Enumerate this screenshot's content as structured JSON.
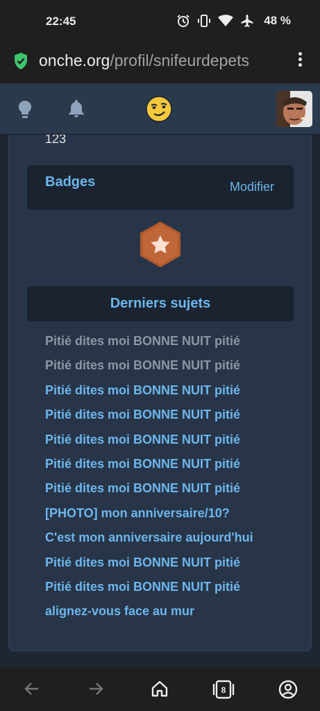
{
  "status_bar": {
    "time": "22:45",
    "battery": "48 %",
    "icons": [
      "alarm-icon",
      "vibrate-icon",
      "wifi-icon",
      "airplane-icon"
    ]
  },
  "browser": {
    "url_domain": "onche.org",
    "url_path": "/profil/snifeurdepets",
    "icons": [
      "shield-check-icon",
      "more-vert-icon"
    ]
  },
  "site_header": {
    "icons": [
      "lightbulb-icon",
      "bell-icon",
      "smiley-logo",
      "avatar"
    ]
  },
  "profile": {
    "number": "123",
    "badges": {
      "title": "Badges",
      "edit_label": "Modifier",
      "badge_icon": "star-hexagon-badge"
    },
    "topics": {
      "title": "Derniers sujets",
      "items": [
        {
          "label": "Pitié dites moi BONNE NUIT pitié",
          "visited": true
        },
        {
          "label": "Pitié dites moi BONNE NUIT pitié",
          "visited": true
        },
        {
          "label": "Pitié dites moi BONNE NUIT pitié",
          "visited": false
        },
        {
          "label": "Pitié dites moi BONNE NUIT pitié",
          "visited": false
        },
        {
          "label": "Pitié dites moi BONNE NUIT pitié",
          "visited": false
        },
        {
          "label": "Pitié dites moi BONNE NUIT pitié",
          "visited": false
        },
        {
          "label": "Pitié dites moi BONNE NUIT pitié",
          "visited": false
        },
        {
          "label": "[PHOTO] mon anniversaire/10?",
          "visited": false
        },
        {
          "label": "C'est mon anniversaire aujourd'hui",
          "visited": false
        },
        {
          "label": "Pitié dites moi BONNE NUIT pitié",
          "visited": false
        },
        {
          "label": "Pitié dites moi BONNE NUIT pitié",
          "visited": false
        },
        {
          "label": "alignez-vous face au mur",
          "visited": false
        }
      ]
    }
  },
  "bottom_nav": {
    "tab_count": "8",
    "icons": [
      "back-arrow-icon",
      "forward-arrow-icon",
      "home-icon",
      "tabs-icon",
      "account-icon"
    ]
  },
  "colors": {
    "link": "#6db6ec",
    "visited": "#8b96a3",
    "card": "#283548",
    "header": "#2b394c",
    "badge": "#b25a2d"
  }
}
